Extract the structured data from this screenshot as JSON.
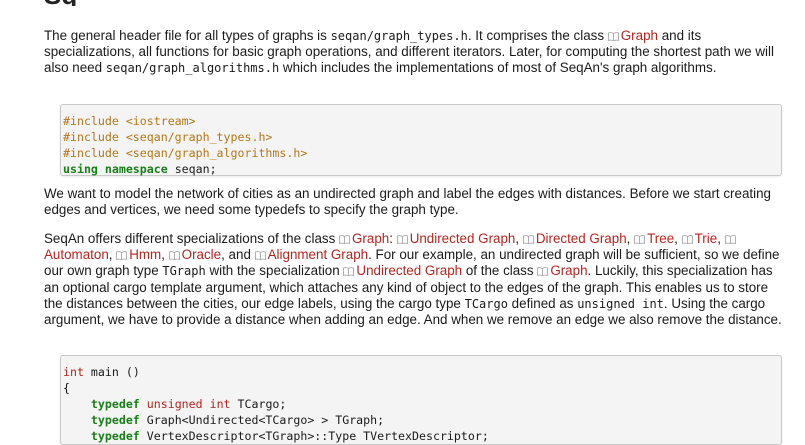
{
  "heading_fragment": "Sq",
  "para1": {
    "t1": "The general header file for all types of graphs is ",
    "code1": "seqan/graph_types.h",
    "t2": ". It comprises the class ",
    "link_graph": "Graph",
    "t3": " and its specializations, all functions for basic graph operations, and different iterators. Later, for computing the shortest path we will also need ",
    "code2": "seqan/graph_algorithms.h",
    "t4": " which includes the implementations of most of SeqAn's graph algorithms."
  },
  "code1": {
    "lines": [
      [
        "#include <iostream>"
      ],
      [
        "#include <seqan/graph_types.h>"
      ],
      [
        "#include <seqan/graph_algorithms.h>"
      ],
      [
        "using",
        " ",
        "namespace",
        " seqan;"
      ]
    ]
  },
  "para2": {
    "text": "We want to model the network of cities as an undirected graph and label the edges with distances. Before we start creating edges and vertices, we need some typedefs to specify the graph type."
  },
  "para3": {
    "t1": "SeqAn offers different specializations of the class ",
    "link_graph": "Graph",
    "t2": ": ",
    "link_undirected": "Undirected Graph",
    "sep1": ", ",
    "link_directed": "Directed Graph",
    "sep2": ", ",
    "link_tree": "Tree",
    "sep3": ", ",
    "link_trie": "Trie",
    "sep4": ", ",
    "link_automaton": "Automaton",
    "sep5": ", ",
    "link_hmm": "Hmm",
    "sep6": ", ",
    "link_oracle": "Oracle",
    "sep7": ", and ",
    "link_alignment": "Alignment Graph",
    "t3": ". For our example, an undirected graph will be sufficient, so we define our own graph type ",
    "code_tgraph": "TGraph",
    "t4": " with the specialization ",
    "link_undirected2": "Undirected Graph",
    "t5": " of the class ",
    "link_graph2": "Graph",
    "t6": ". Luckily, this specialization has an optional cargo template argument, which attaches any kind of object to the edges of the graph. This enables us to store the distances between the cities, our edge labels, using the cargo type ",
    "code_tcargo": "TCargo",
    "t7": " defined as ",
    "code_unsigned": "unsigned int",
    "t8": ". Using the cargo argument, we have to provide a distance when adding an edge. And when we remove an edge we also remove the distance."
  },
  "code2": {
    "l1_type": "int",
    "l1_rest": " main ()",
    "l2": "{",
    "l3_kw": "typedef",
    "l3_sp": " ",
    "l3_type": "unsigned int",
    "l3_rest": " TCargo;",
    "l4_kw": "typedef",
    "l4_rest": " Graph<Undirected<TCargo> > TGraph;",
    "l5_kw": "typedef",
    "l5_rest": " VertexDescriptor<TGraph>::Type TVertexDescriptor;"
  },
  "colors": {
    "link": "#b3261e",
    "preprocessor": "#b5761a",
    "keyword": "#1a7f1a",
    "code_background": "#f4f4f4"
  },
  "icons": {
    "doc_link": "book-icon"
  }
}
